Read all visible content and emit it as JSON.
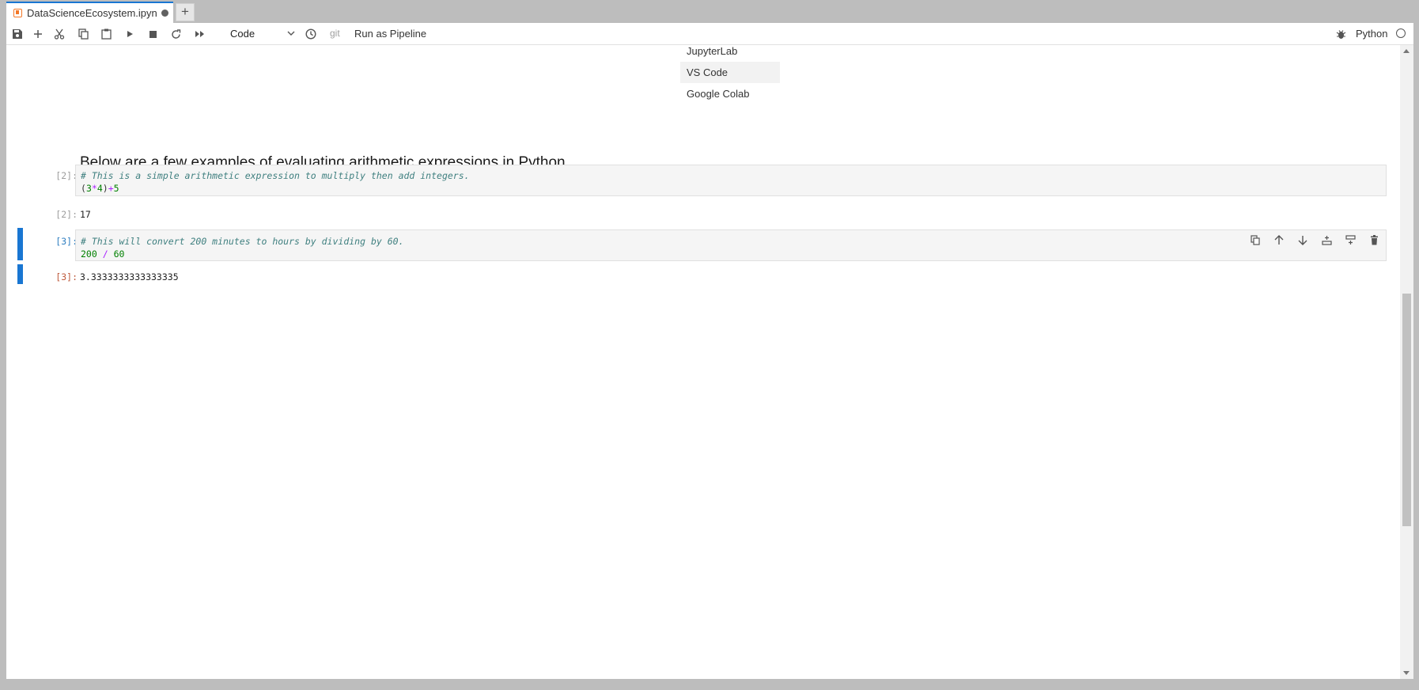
{
  "tab": {
    "title": "DataScienceEcosystem.ipyn",
    "new_tab_label": "+"
  },
  "toolbar": {
    "buttons": [
      "save-icon",
      "add-cell-icon",
      "cut-icon",
      "copy-icon",
      "paste-icon",
      "run-icon",
      "stop-icon",
      "restart-icon",
      "run-all-icon",
      "history-icon"
    ],
    "cell_type": "Code",
    "git_label": "git",
    "run_pipeline_label": "Run as Pipeline",
    "kernel_name": "Python"
  },
  "notebook": {
    "list_items": [
      "JupyterLab",
      "VS Code",
      "Google Colab"
    ],
    "heading": "Below are a few examples of evaluating arithmetic expressions in Python.",
    "cells": [
      {
        "in_prompt": "[2]:",
        "comment": "# This is a simple arithmetic expression to multiply then add integers.",
        "out_prompt": "[2]:",
        "output": "17"
      },
      {
        "in_prompt": "[3]:",
        "comment": "# This will convert 200 minutes to hours by dividing by 60.",
        "out_prompt": "[3]:",
        "output": "3.3333333333333335"
      }
    ],
    "cell_tools": [
      "duplicate-cell-icon",
      "move-up-icon",
      "move-down-icon",
      "insert-above-icon",
      "insert-below-icon",
      "delete-cell-icon"
    ]
  },
  "colors": {
    "accent": "#1976d2",
    "notebook_icon": "#f37726",
    "comment": "#408080",
    "number": "#008000",
    "operator": "#aa22ff"
  }
}
